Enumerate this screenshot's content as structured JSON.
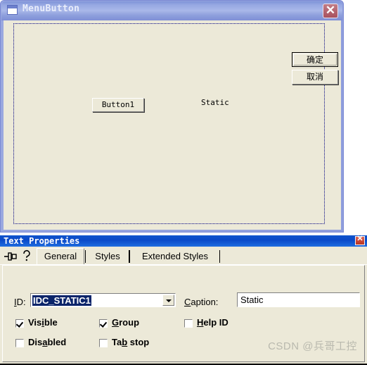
{
  "dialog_editor": {
    "title": "MenuButton",
    "title_icon": "window-icon",
    "close_label": "✕",
    "controls": {
      "ok_button": "确定",
      "cancel_button": "取消",
      "push_button": "Button1",
      "static_text": "Static"
    }
  },
  "properties_panel": {
    "title": "Text Properties",
    "close_label": "✕",
    "toolbar": {
      "pin_icon": "pushpin-icon",
      "help_icon": "?"
    },
    "tabs": [
      {
        "label": "General",
        "selected": true
      },
      {
        "label": "Styles",
        "selected": false
      },
      {
        "label": "Extended Styles",
        "selected": false
      }
    ],
    "fields": {
      "id_label": "ID:",
      "id_label_accel": "I",
      "id_label_rest": "D:",
      "id_value": "IDC_STATIC1",
      "caption_label_accel": "C",
      "caption_label_rest": "aption:",
      "caption_value": "Static"
    },
    "checkboxes": [
      {
        "label_pre": "Vis",
        "label_accel": "i",
        "label_post": "ble",
        "checked": true,
        "name": "visible"
      },
      {
        "label_pre": "",
        "label_accel": "G",
        "label_post": "roup",
        "checked": true,
        "name": "group"
      },
      {
        "label_pre": "",
        "label_accel": "H",
        "label_post": "elp ID",
        "checked": false,
        "name": "help-id"
      },
      {
        "label_pre": "Dis",
        "label_accel": "a",
        "label_post": "bled",
        "checked": false,
        "name": "disabled"
      },
      {
        "label_pre": "Ta",
        "label_accel": "b",
        "label_post": " stop",
        "checked": false,
        "name": "tab-stop"
      }
    ]
  },
  "watermark": "CSDN @兵哥工控",
  "colors": {
    "face": "#ece9d8",
    "dialog_titlebar": "#9aa8e0",
    "panel_titlebar": "#0a49c8",
    "selection": "#0a246a",
    "dotted_border": "#000080"
  }
}
